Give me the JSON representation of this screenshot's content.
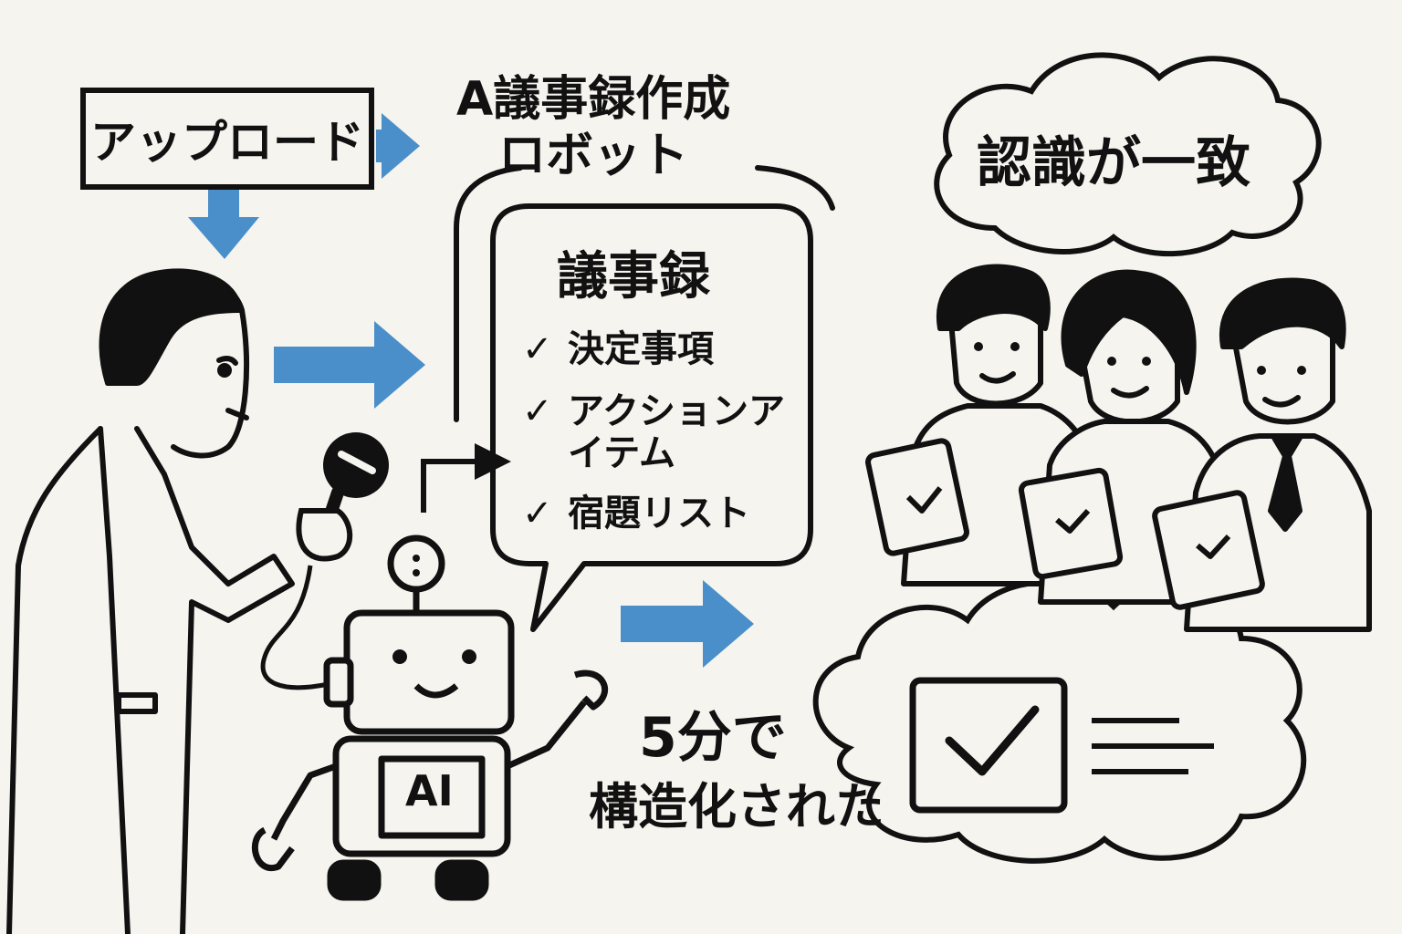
{
  "upload": {
    "label": "アップロード"
  },
  "robot_title": {
    "line1": "A議事録作成",
    "line2": "ロボット"
  },
  "minutes_bubble": {
    "heading": "議事録",
    "items": [
      "決定事項",
      "アクションア",
      "イテム",
      "宿題リスト"
    ]
  },
  "consensus_cloud": {
    "label": "認識が一致"
  },
  "result": {
    "line1": "5分で",
    "line2": "構造化された"
  },
  "robot": {
    "chest_label": "AI"
  },
  "colors": {
    "arrow": "#4a8fc9",
    "ink": "#111111",
    "background": "#f5f4ef"
  },
  "icons": [
    "arrow-right-icon",
    "arrow-down-icon",
    "check-icon",
    "microphone-icon",
    "tablet-check-icon",
    "document-check-icon"
  ]
}
